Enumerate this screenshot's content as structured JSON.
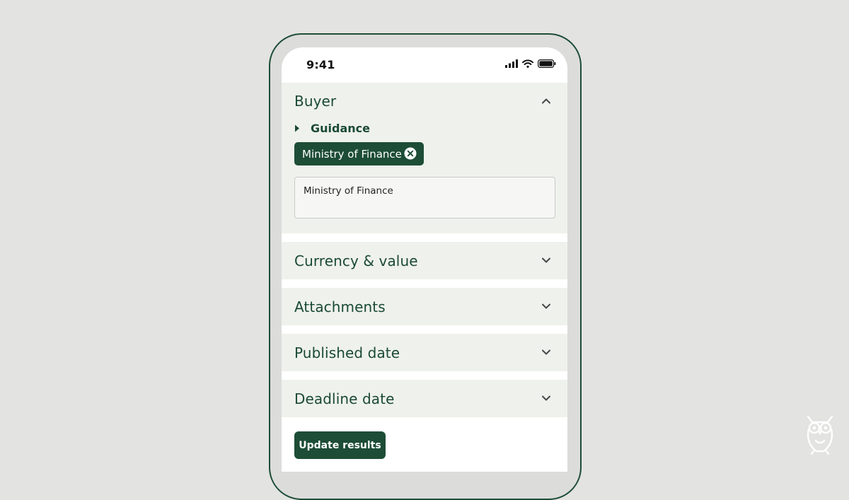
{
  "status_bar": {
    "time": "9:41",
    "icons": [
      "signal-icon",
      "wifi-icon",
      "battery-icon"
    ]
  },
  "filters": {
    "buyer": {
      "title": "Buyer",
      "expanded": true,
      "guidance_label": "Guidance",
      "selected_chip": "Ministry of Finance",
      "input_value": "Ministry of Finance"
    },
    "currency": {
      "title": "Currency & value",
      "expanded": false
    },
    "attachments": {
      "title": "Attachments",
      "expanded": false
    },
    "published": {
      "title": "Published date",
      "expanded": false
    },
    "deadline": {
      "title": "Deadline date",
      "expanded": false
    }
  },
  "actions": {
    "update_label": "Update results"
  },
  "colors": {
    "brand_green": "#1d4d36",
    "heading_green": "#1a4a33",
    "panel_bg": "#eff1ec",
    "page_bg": "#e3e3e2"
  },
  "logo": {
    "icon": "owl-icon"
  }
}
